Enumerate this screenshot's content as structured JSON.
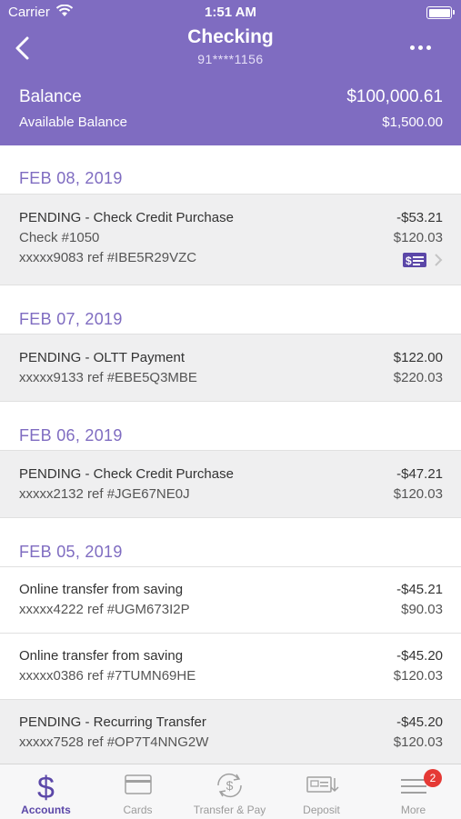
{
  "status": {
    "carrier": "Carrier",
    "time": "1:51 AM"
  },
  "nav": {
    "title": "Checking",
    "account_masked": "91****1156"
  },
  "balance": {
    "label": "Balance",
    "value": "$100,000.61",
    "available_label": "Available Balance",
    "available_value": "$1,500.00"
  },
  "sections": [
    {
      "date": "FEB 08, 2019",
      "items": [
        {
          "desc": "PENDING - Check Credit Purchase",
          "amount": "-$53.21",
          "check": "Check #1050",
          "balance": "$120.03",
          "ref": "xxxxx9083 ref #IBE5R29VZC",
          "has_check_icon": true
        }
      ]
    },
    {
      "date": "FEB 07, 2019",
      "items": [
        {
          "desc": "PENDING - OLTT Payment",
          "amount": "$122.00",
          "ref": "xxxxx9133 ref #EBE5Q3MBE",
          "balance": "$220.03"
        }
      ]
    },
    {
      "date": "FEB 06, 2019",
      "items": [
        {
          "desc": "PENDING - Check Credit Purchase",
          "amount": "-$47.21",
          "ref": "xxxxx2132 ref #JGE67NE0J",
          "balance": "$120.03"
        }
      ]
    },
    {
      "date": "FEB 05, 2019",
      "items": [
        {
          "desc": "Online transfer from saving",
          "amount": "-$45.21",
          "ref": "xxxxx4222 ref #UGM673I2P",
          "balance": "$90.03"
        },
        {
          "desc": "Online transfer from saving",
          "amount": "-$45.20",
          "ref": "xxxxx0386 ref #7TUMN69HE",
          "balance": "$120.03"
        },
        {
          "desc": "PENDING - Recurring Transfer",
          "amount": "-$45.20",
          "ref": "xxxxx7528 ref #OP7T4NNG2W",
          "balance": "$120.03"
        }
      ]
    }
  ],
  "tabs": [
    {
      "label": "Accounts",
      "icon": "dollar-icon",
      "active": true
    },
    {
      "label": "Cards",
      "icon": "card-icon"
    },
    {
      "label": "Transfer & Pay",
      "icon": "transfer-icon"
    },
    {
      "label": "Deposit",
      "icon": "deposit-check-icon"
    },
    {
      "label": "More",
      "icon": "menu-icon",
      "badge": "2"
    }
  ],
  "colors": {
    "brand": "#7f6cc1",
    "tab_active": "#5b47a8",
    "pending_bg": "#efeff0",
    "badge": "#e53935"
  }
}
